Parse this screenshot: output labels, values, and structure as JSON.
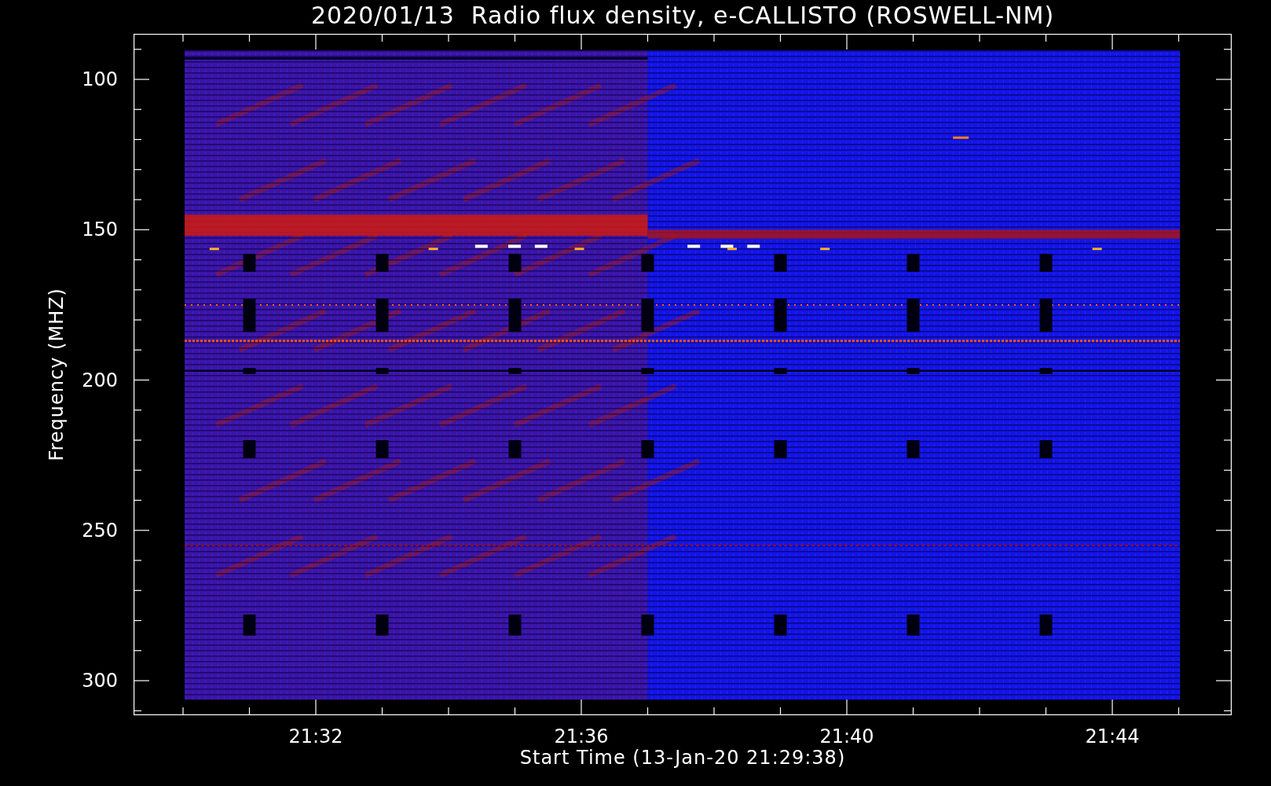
{
  "title": "2020/01/13  Radio flux density, e-CALLISTO (ROSWELL-NM)",
  "y_axis": {
    "label": "Frequency (MHZ)",
    "ticks": [
      "100",
      "150",
      "200",
      "250",
      "300"
    ]
  },
  "x_axis": {
    "label": "Start Time (13-Jan-20 21:29:38)",
    "ticks": [
      "21:32",
      "21:36",
      "21:40",
      "21:44"
    ]
  }
}
